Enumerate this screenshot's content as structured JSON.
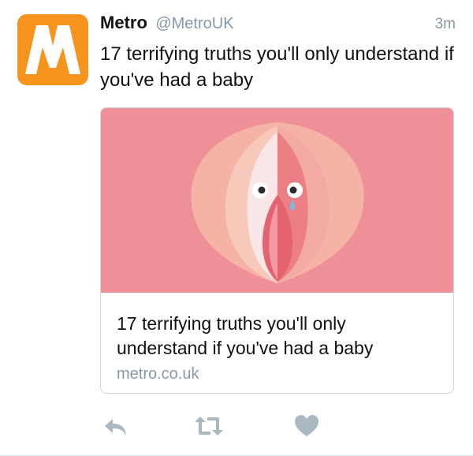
{
  "account": {
    "name": "Metro",
    "handle": "@MetroUK",
    "avatar_letter": "M",
    "avatar_color": "#f7941d"
  },
  "tweet": {
    "timestamp": "3m",
    "text": "17 terrifying truths you'll only understand if you've had a baby"
  },
  "card": {
    "title": "17 terrifying truths you'll only understand if you've had a baby",
    "domain": "metro.co.uk",
    "image_background": "#ef8f97"
  },
  "actions": {
    "icons": [
      "reply-icon",
      "retweet-icon",
      "like-icon"
    ],
    "icon_color": "#aab8c2"
  }
}
